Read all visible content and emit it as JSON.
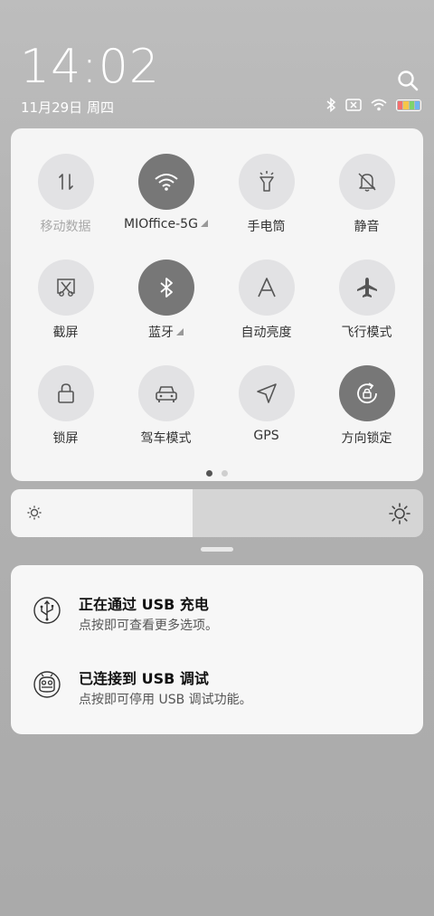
{
  "status": {
    "time": "14:02",
    "date": "11月29日 周四",
    "icons": [
      "bluetooth-icon",
      "no-sim-icon",
      "wifi-icon",
      "battery-icon"
    ],
    "battery_colors": [
      "#f36f6f",
      "#f6c64a",
      "#7ed36c",
      "#6fb3f0"
    ]
  },
  "quick_settings": {
    "tiles": [
      {
        "label": "移动数据",
        "icon": "mobile-data-icon",
        "on": false,
        "dim": true
      },
      {
        "label": "MIOffice-5G",
        "icon": "wifi-icon",
        "on": true,
        "expand": true
      },
      {
        "label": "手电筒",
        "icon": "flashlight-icon",
        "on": false
      },
      {
        "label": "静音",
        "icon": "bell-off-icon",
        "on": false
      },
      {
        "label": "截屏",
        "icon": "screenshot-icon",
        "on": false
      },
      {
        "label": "蓝牙",
        "icon": "bluetooth-icon",
        "on": true,
        "expand": true
      },
      {
        "label": "自动亮度",
        "icon": "auto-brightness-icon",
        "on": false
      },
      {
        "label": "飞行模式",
        "icon": "airplane-icon",
        "on": false
      },
      {
        "label": "锁屏",
        "icon": "lock-icon",
        "on": false
      },
      {
        "label": "驾车模式",
        "icon": "car-icon",
        "on": false
      },
      {
        "label": "GPS",
        "icon": "gps-icon",
        "on": false
      },
      {
        "label": "方向锁定",
        "icon": "rotation-lock-icon",
        "on": true
      }
    ],
    "pages": 2,
    "active_page": 1
  },
  "brightness": {
    "level": 0.44
  },
  "notifications": [
    {
      "title": "正在通过 USB 充电",
      "subtitle": "点按即可查看更多选项。",
      "icon": "usb-icon"
    },
    {
      "title": "已连接到 USB 调试",
      "subtitle": "点按即可停用 USB 调试功能。",
      "icon": "android-debug-icon"
    }
  ],
  "colors": {
    "tile_on": "#777777",
    "tile_off": "#e2e2e4",
    "panel": "#f5f5f5"
  }
}
